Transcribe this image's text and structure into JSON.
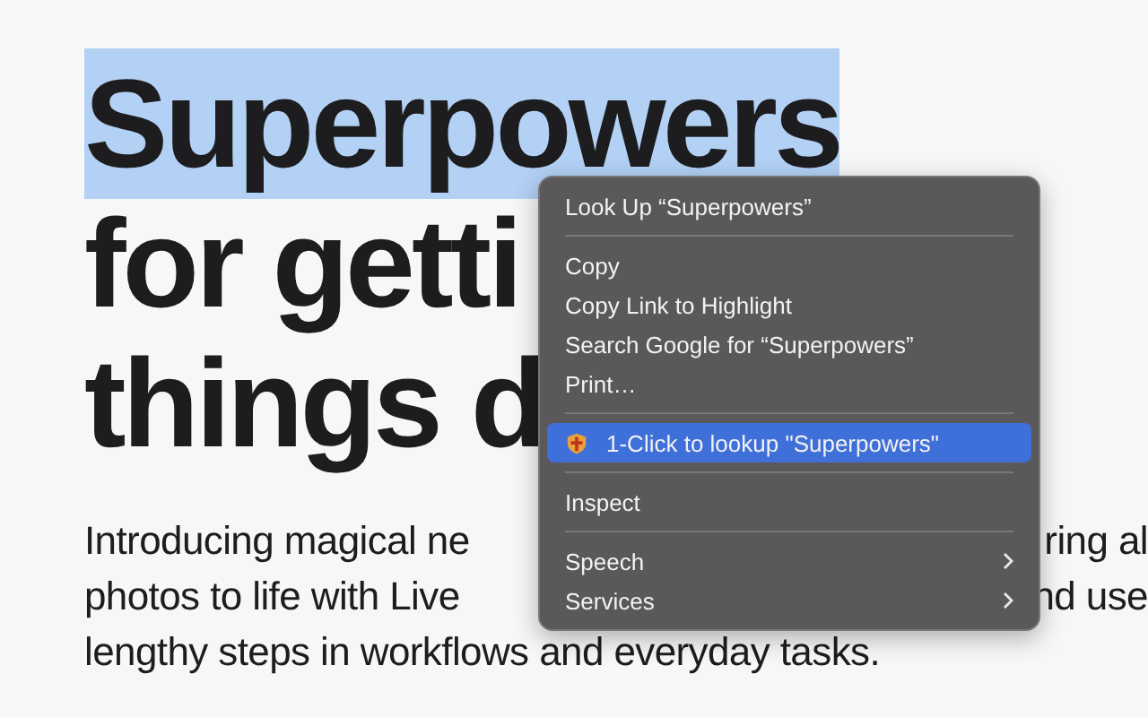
{
  "headline": [
    {
      "text": "Superpowers",
      "selected": true
    },
    {
      "text": "for getti",
      "selected": false
    },
    {
      "text": "things d",
      "selected": false
    }
  ],
  "body": [
    {
      "left": "Introducing magical ne",
      "right": "ring al"
    },
    {
      "left": "photos to life with Live",
      "right": "nd use"
    },
    {
      "left": "lengthy steps in workflows and everyday tasks."
    }
  ],
  "context_menu": {
    "items": [
      {
        "kind": "item",
        "label": "Look Up “Superpowers”",
        "selected": false
      },
      {
        "kind": "separator"
      },
      {
        "kind": "item",
        "label": "Copy",
        "selected": false
      },
      {
        "kind": "item",
        "label": "Copy Link to Highlight",
        "selected": false
      },
      {
        "kind": "item",
        "label": "Search Google for “Superpowers”",
        "selected": false
      },
      {
        "kind": "item",
        "label": "Print…",
        "selected": false
      },
      {
        "kind": "separator"
      },
      {
        "kind": "app-item",
        "label": "1-Click to lookup \"Superpowers\"",
        "selected": true
      },
      {
        "kind": "separator"
      },
      {
        "kind": "item",
        "label": "Inspect",
        "selected": false
      },
      {
        "kind": "separator"
      },
      {
        "kind": "submenu",
        "label": "Speech",
        "selected": false
      },
      {
        "kind": "submenu",
        "label": "Services",
        "selected": false
      }
    ]
  }
}
